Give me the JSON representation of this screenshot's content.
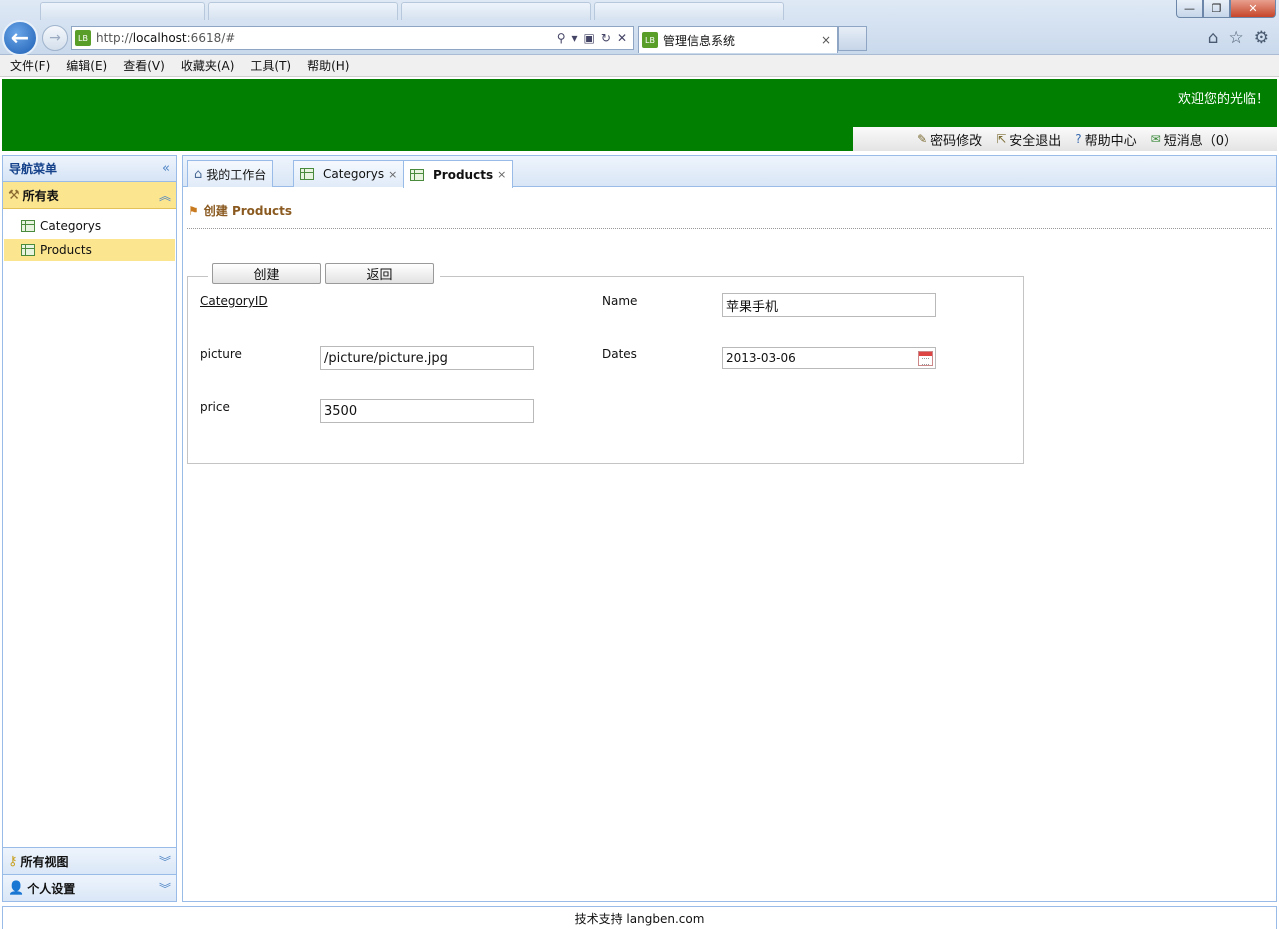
{
  "browser": {
    "url_prefix": "http://",
    "url_host": "localhost",
    "url_rest": ":6618/#",
    "tab_title": "管理信息系统",
    "tab_close": "×",
    "favicon_text": "LB"
  },
  "menubar": [
    "文件(F)",
    "编辑(E)",
    "查看(V)",
    "收藏夹(A)",
    "工具(T)",
    "帮助(H)"
  ],
  "header": {
    "welcome": "欢迎您的光临！",
    "toolbar": {
      "change_password": "密码修改",
      "logout": "安全退出",
      "help": "帮助中心",
      "messages": "短消息（0）"
    },
    "bg_color": "#007f00"
  },
  "sidebar": {
    "title": "导航菜单",
    "groups": [
      {
        "label": "所有表",
        "items": [
          "Categorys",
          "Products"
        ],
        "selected": "Products"
      },
      {
        "label": "所有视图"
      },
      {
        "label": "个人设置"
      }
    ]
  },
  "tabs": [
    {
      "label": "我的工作台",
      "closable": false
    },
    {
      "label": "Categorys",
      "closable": true
    },
    {
      "label": "Products",
      "closable": true,
      "active": true
    }
  ],
  "tab_close": "×",
  "page": {
    "title": "创建 Products",
    "buttons": {
      "create": "创建",
      "back": "返回"
    },
    "fields": {
      "categoryid_label": "CategoryID",
      "name_label": "Name",
      "name_value": "苹果手机",
      "picture_label": "picture",
      "picture_value": "/picture/picture.jpg",
      "dates_label": "Dates",
      "dates_value": "2013-03-06",
      "price_label": "price",
      "price_value": "3500"
    }
  },
  "footer": "技术支持 langben.com"
}
